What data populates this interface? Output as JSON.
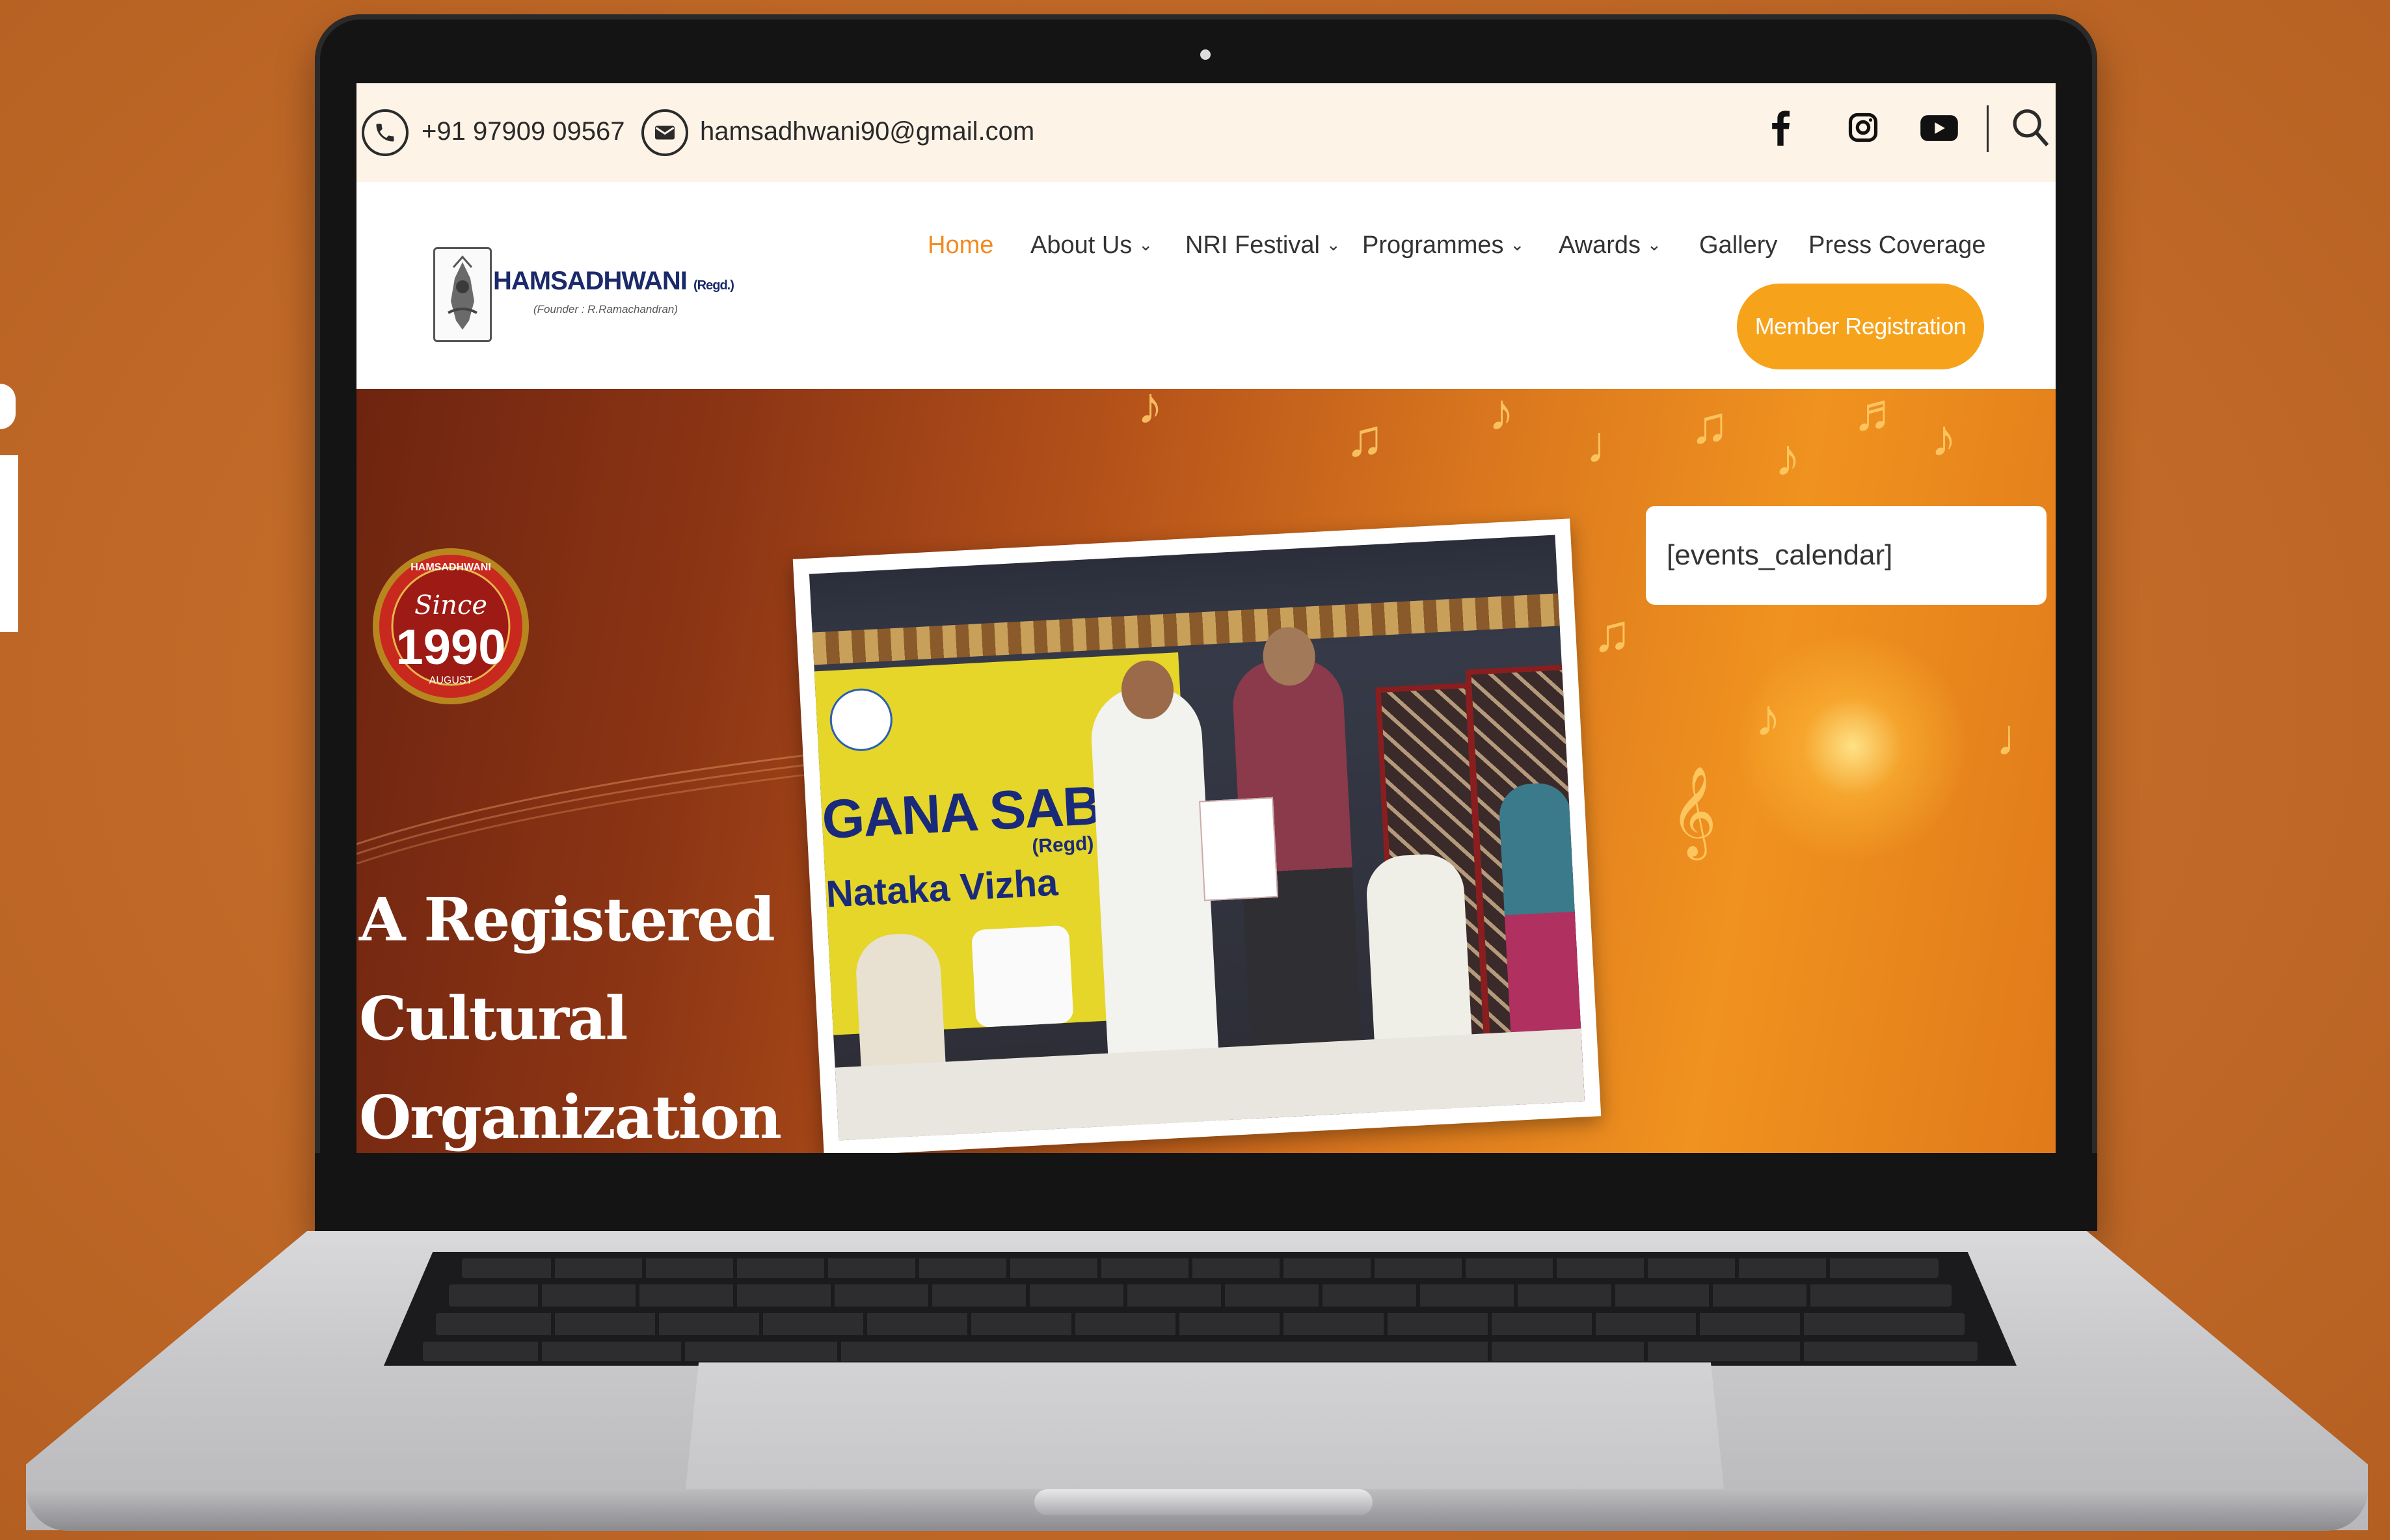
{
  "topbar": {
    "phone": "+91 97909 09567",
    "email": "hamsadhwani90@gmail.com",
    "social_icons": [
      "facebook-icon",
      "instagram-icon",
      "youtube-icon",
      "search-icon"
    ]
  },
  "logo": {
    "title": "HAMSADHWANI",
    "regd": "(Regd.)",
    "founder": "(Founder : R.Ramachandran)"
  },
  "nav": {
    "items": [
      {
        "label": "Home",
        "active": true,
        "dropdown": false
      },
      {
        "label": "About Us",
        "active": false,
        "dropdown": true
      },
      {
        "label": "NRI Festival",
        "active": false,
        "dropdown": true
      },
      {
        "label": "Programmes",
        "active": false,
        "dropdown": true
      },
      {
        "label": "Awards",
        "active": false,
        "dropdown": true
      },
      {
        "label": "Gallery",
        "active": false,
        "dropdown": false
      },
      {
        "label": "Press Coverage",
        "active": false,
        "dropdown": false
      }
    ],
    "cta": "Member Registration",
    "active_color": "#f28a1f",
    "cta_color": "#f6a21a"
  },
  "hero": {
    "badge": {
      "top_text": "HAMSADHWANI",
      "since": "Since",
      "year": "1990",
      "month": "AUGUST"
    },
    "title_lines": [
      "A Registered",
      "Cultural",
      "Organization"
    ],
    "photo": {
      "banner_text": "GANA SABHA",
      "banner_regd": "(Regd)",
      "banner_sub": "Nataka Vizha"
    },
    "events_placeholder": "[events_calendar]"
  },
  "colors": {
    "background": "#c26a28",
    "topbar": "#fdf3e7",
    "logo_text": "#1b2a6a"
  }
}
